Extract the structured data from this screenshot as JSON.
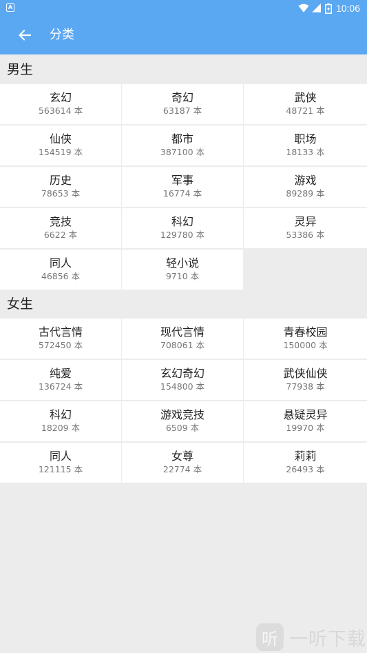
{
  "status_bar": {
    "time": "10:06",
    "left_icon": "A"
  },
  "toolbar": {
    "title": "分类",
    "back_icon": "arrow-left-icon"
  },
  "sections": [
    {
      "title": "男生",
      "items": [
        {
          "name": "玄幻",
          "count": "563614 本"
        },
        {
          "name": "奇幻",
          "count": "63187 本"
        },
        {
          "name": "武侠",
          "count": "48721 本"
        },
        {
          "name": "仙侠",
          "count": "154519 本"
        },
        {
          "name": "都市",
          "count": "387100 本"
        },
        {
          "name": "职场",
          "count": "18133 本"
        },
        {
          "name": "历史",
          "count": "78653 本"
        },
        {
          "name": "军事",
          "count": "16774 本"
        },
        {
          "name": "游戏",
          "count": "89289 本"
        },
        {
          "name": "竞技",
          "count": "6622 本"
        },
        {
          "name": "科幻",
          "count": "129780 本"
        },
        {
          "name": "灵异",
          "count": "53386 本"
        },
        {
          "name": "同人",
          "count": "46856 本"
        },
        {
          "name": "轻小说",
          "count": "9710 本"
        }
      ]
    },
    {
      "title": "女生",
      "items": [
        {
          "name": "古代言情",
          "count": "572450 本"
        },
        {
          "name": "现代言情",
          "count": "708061 本"
        },
        {
          "name": "青春校园",
          "count": "150000 本"
        },
        {
          "name": "纯爱",
          "count": "136724 本"
        },
        {
          "name": "玄幻奇幻",
          "count": "154800 本"
        },
        {
          "name": "武侠仙侠",
          "count": "77938 本"
        },
        {
          "name": "科幻",
          "count": "18209 本"
        },
        {
          "name": "游戏竞技",
          "count": "6509 本"
        },
        {
          "name": "悬疑灵异",
          "count": "19970 本"
        },
        {
          "name": "同人",
          "count": "121115 本"
        },
        {
          "name": "女尊",
          "count": "22774 本"
        },
        {
          "name": "莉莉",
          "count": "26493 本"
        }
      ]
    }
  ],
  "watermark": {
    "logo_text": "听",
    "text": "一听下载"
  },
  "colors": {
    "primary": "#5aa7f2",
    "background": "#ececec",
    "cell": "#ffffff"
  }
}
